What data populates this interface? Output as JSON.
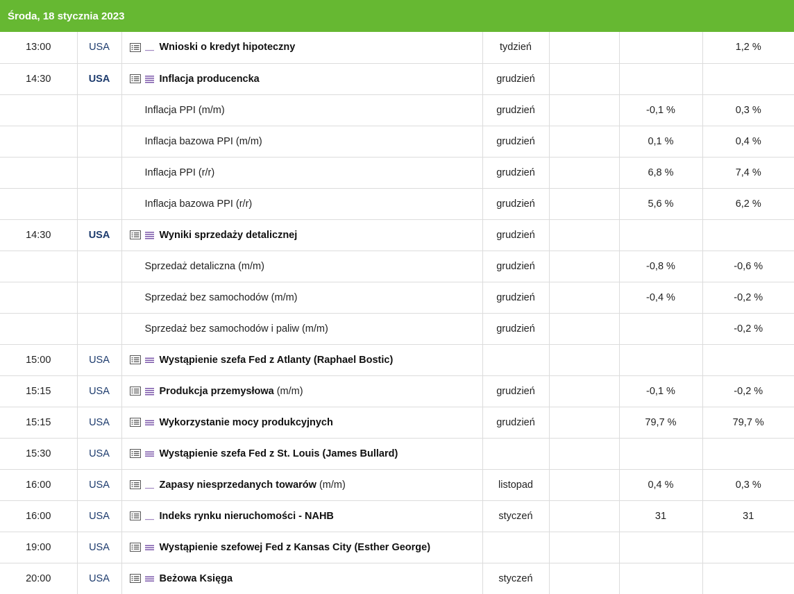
{
  "header": {
    "date": "Środa, 18 stycznia 2023"
  },
  "colors": {
    "header_bg": "#66b832",
    "importance": "#7a55a8",
    "country": "#1e3c6e"
  },
  "rows": [
    {
      "time": "13:00",
      "country": "USA",
      "country_bold": false,
      "title": "Wnioski o kredyt hipoteczny",
      "suffix": "",
      "importance": "low",
      "period": "tydzień",
      "forecast": "",
      "previous": "1,2 %"
    },
    {
      "time": "14:30",
      "country": "USA",
      "country_bold": true,
      "title": "Inflacja producencka",
      "suffix": "",
      "importance": "high",
      "period": "grudzień",
      "forecast": "",
      "previous": ""
    },
    {
      "sub": true,
      "title": "Inflacja PPI (m/m)",
      "period": "grudzień",
      "forecast": "-0,1 %",
      "previous": "0,3 %"
    },
    {
      "sub": true,
      "title": "Inflacja bazowa PPI (m/m)",
      "period": "grudzień",
      "forecast": "0,1 %",
      "previous": "0,4 %"
    },
    {
      "sub": true,
      "title": "Inflacja PPI (r/r)",
      "period": "grudzień",
      "forecast": "6,8 %",
      "previous": "7,4 %"
    },
    {
      "sub": true,
      "title": "Inflacja bazowa PPI (r/r)",
      "period": "grudzień",
      "forecast": "5,6 %",
      "previous": "6,2 %"
    },
    {
      "time": "14:30",
      "country": "USA",
      "country_bold": true,
      "title": "Wyniki sprzedaży detalicznej",
      "suffix": "",
      "importance": "high",
      "period": "grudzień",
      "forecast": "",
      "previous": ""
    },
    {
      "sub": true,
      "title": "Sprzedaż detaliczna (m/m)",
      "period": "grudzień",
      "forecast": "-0,8 %",
      "previous": "-0,6 %"
    },
    {
      "sub": true,
      "title": "Sprzedaż bez samochodów (m/m)",
      "period": "grudzień",
      "forecast": "-0,4 %",
      "previous": "-0,2 %"
    },
    {
      "sub": true,
      "title": "Sprzedaż bez samochodów i paliw (m/m)",
      "period": "grudzień",
      "forecast": "",
      "previous": "-0,2 %"
    },
    {
      "time": "15:00",
      "country": "USA",
      "country_bold": false,
      "title": "Wystąpienie szefa Fed z Atlanty (Raphael Bostic)",
      "suffix": "",
      "importance": "medium",
      "period": "",
      "forecast": "",
      "previous": ""
    },
    {
      "time": "15:15",
      "country": "USA",
      "country_bold": false,
      "title": "Produkcja przemysłowa",
      "suffix": "(m/m)",
      "importance": "high",
      "period": "grudzień",
      "forecast": "-0,1 %",
      "previous": "-0,2 %"
    },
    {
      "time": "15:15",
      "country": "USA",
      "country_bold": false,
      "title": "Wykorzystanie mocy produkcyjnych",
      "suffix": "",
      "importance": "medium",
      "period": "grudzień",
      "forecast": "79,7 %",
      "previous": "79,7 %"
    },
    {
      "time": "15:30",
      "country": "USA",
      "country_bold": false,
      "title": "Wystąpienie szefa Fed z St. Louis (James Bullard)",
      "suffix": "",
      "importance": "medium",
      "period": "",
      "forecast": "",
      "previous": ""
    },
    {
      "time": "16:00",
      "country": "USA",
      "country_bold": false,
      "title": "Zapasy niesprzedanych towarów",
      "suffix": "(m/m)",
      "importance": "low",
      "period": "listopad",
      "forecast": "0,4 %",
      "previous": "0,3 %"
    },
    {
      "time": "16:00",
      "country": "USA",
      "country_bold": false,
      "title": "Indeks rynku nieruchomości - NAHB",
      "suffix": "",
      "importance": "low",
      "period": "styczeń",
      "forecast": "31",
      "previous": "31"
    },
    {
      "time": "19:00",
      "country": "USA",
      "country_bold": false,
      "title": "Wystąpienie szefowej Fed z Kansas City (Esther George)",
      "suffix": "",
      "importance": "medium",
      "period": "",
      "forecast": "",
      "previous": ""
    },
    {
      "time": "20:00",
      "country": "USA",
      "country_bold": false,
      "title": "Beżowa Księga",
      "suffix": "",
      "importance": "medium",
      "period": "styczeń",
      "forecast": "",
      "previous": ""
    }
  ]
}
